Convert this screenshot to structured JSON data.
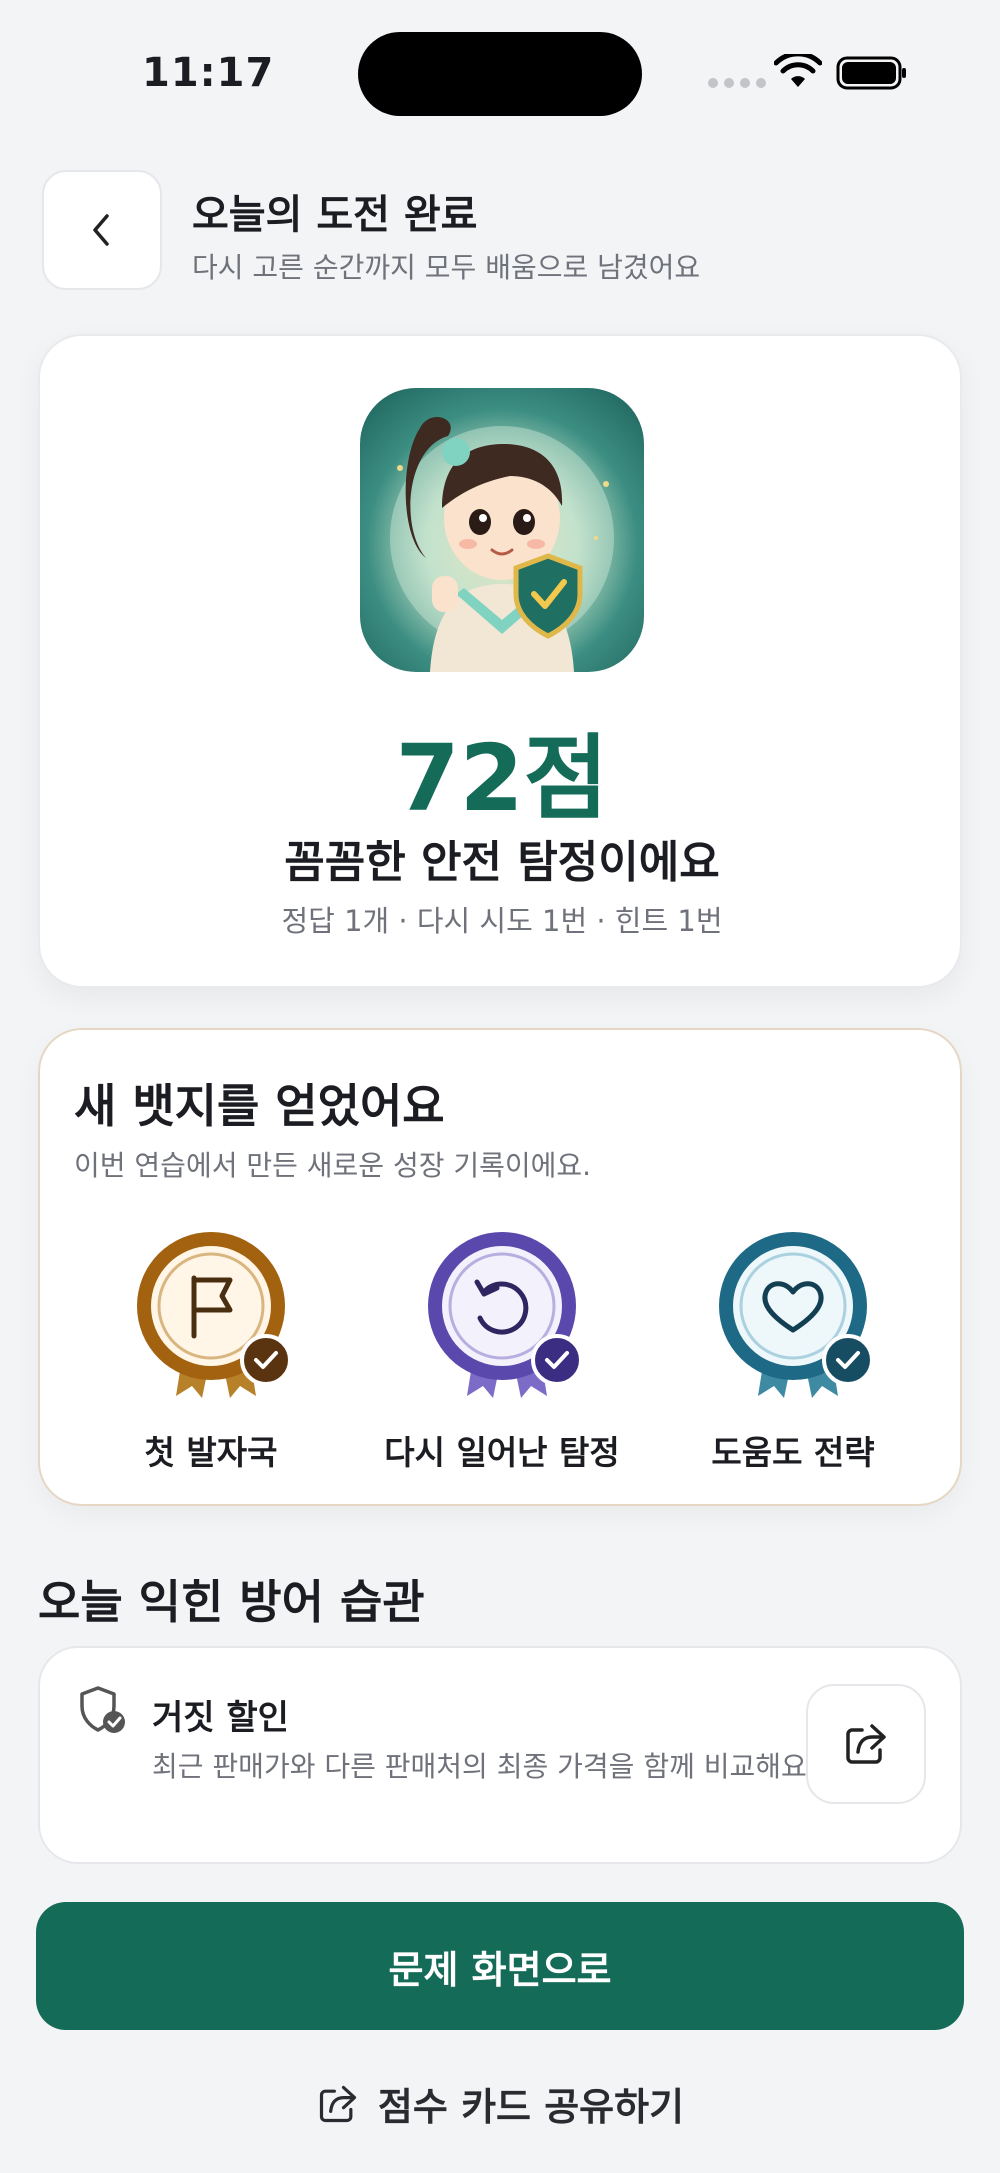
{
  "status_bar": {
    "time": "11:17"
  },
  "header": {
    "back_icon": "chevron-left-icon",
    "title": "오늘의 도전 완료",
    "subtitle": "다시 고른 순간까지 모두 배움으로 남겼어요"
  },
  "score": {
    "value": "72점",
    "title": "꼼꼼한 안전 탐정이에요",
    "meta": "정답 1개 · 다시 시도 1번 · 힌트 1번",
    "accent_color": "#146b58"
  },
  "badges": {
    "title": "새 뱃지를 얻었어요",
    "subtitle": "이번 연습에서 만든 새로운 성장 기록이에요.",
    "items": [
      {
        "label": "첫 발자국",
        "icon": "flag-icon",
        "color": "#a3620f"
      },
      {
        "label": "다시 일어난 탐정",
        "icon": "retry-icon",
        "color": "#5b48ad"
      },
      {
        "label": "도움도 전략",
        "icon": "heart-icon",
        "color": "#1e6a86"
      }
    ]
  },
  "habits": {
    "section_title": "오늘 익힌 방어 습관",
    "item": {
      "icon": "shield-check-icon",
      "title": "거짓 할인",
      "description": "최근 판매가와 다른 판매처의 최종 가격을 함께 비교해요.",
      "action_icon": "share-icon"
    }
  },
  "actions": {
    "primary": "문제 화면으로",
    "share": "점수 카드 공유하기",
    "share_icon": "share-icon"
  }
}
